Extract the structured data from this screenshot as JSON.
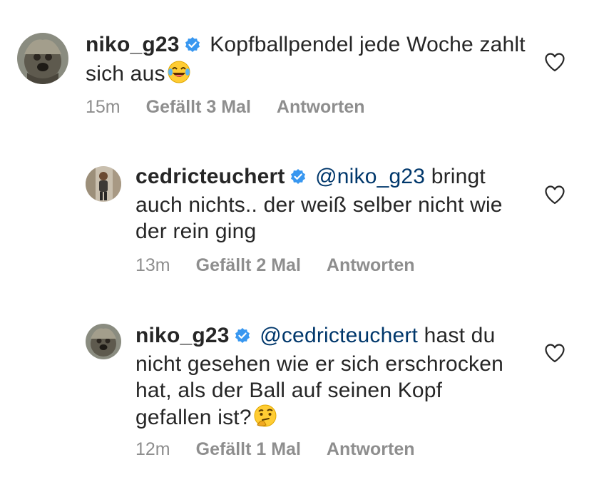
{
  "comments": [
    {
      "username": "niko_g23",
      "mention": "",
      "text": "Kopfballpendel jede Woche zahlt sich aus",
      "emoji": "tears-of-joy-emoji",
      "time": "15m",
      "likes": "Gefällt 3 Mal",
      "reply": "Antworten",
      "avatar": "dog-avatar"
    },
    {
      "username": "cedricteuchert",
      "mention": "@niko_g23",
      "text": "bringt auch nichts.. der weiß selber nicht wie der rein ging",
      "emoji": "",
      "time": "13m",
      "likes": "Gefällt 2 Mal",
      "reply": "Antworten",
      "avatar": "person-avatar"
    },
    {
      "username": "niko_g23",
      "mention": "@cedricteuchert",
      "text": "hast du nicht gesehen wie er sich erschrocken hat, als der Ball auf seinen Kopf gefallen ist?",
      "emoji": "thinking-face-emoji",
      "time": "12m",
      "likes": "Gefällt 1 Mal",
      "reply": "Antworten",
      "avatar": "dog-avatar"
    }
  ],
  "colors": {
    "verified": "#3897f0",
    "mention": "#00376b",
    "meta": "#8e8e8e",
    "text": "#262626"
  }
}
